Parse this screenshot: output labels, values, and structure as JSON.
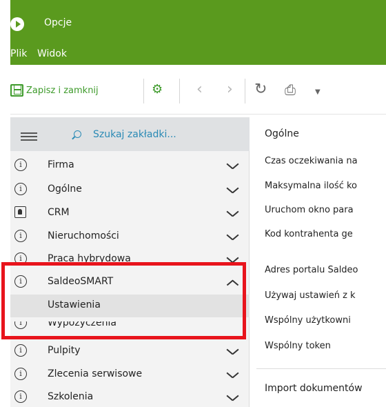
{
  "window": {
    "title": "Opcje"
  },
  "menubar": {
    "items": [
      "Plik",
      "Widok"
    ]
  },
  "toolbar": {
    "save_label": "Zapisz i zamknij",
    "icons": [
      "save-icon",
      "tools-icon",
      "back-icon",
      "forward-icon",
      "refresh-icon",
      "print-icon",
      "dropdown-arrow-icon"
    ]
  },
  "sidebar": {
    "search_placeholder": "Szukaj zakładki...",
    "items": [
      {
        "label": "Firma",
        "icon": "info-icon",
        "expanded": false
      },
      {
        "label": "Ogólne",
        "icon": "info-icon",
        "expanded": false
      },
      {
        "label": "CRM",
        "icon": "contact-card-icon",
        "expanded": false
      },
      {
        "label": "Nieruchomości",
        "icon": "info-icon",
        "expanded": false
      },
      {
        "label": "Praca hybrydowa",
        "icon": "info-icon",
        "expanded": false
      },
      {
        "label": "SaldeoSMART",
        "icon": "info-icon",
        "expanded": true
      },
      {
        "label": "Wypożyczenia",
        "icon": "info-icon",
        "expanded": false
      },
      {
        "label": "Pulpity",
        "icon": "info-icon",
        "expanded": false
      },
      {
        "label": "Zlecenia serwisowe",
        "icon": "info-icon",
        "expanded": false
      },
      {
        "label": "Szkolenia",
        "icon": "info-icon",
        "expanded": false
      }
    ],
    "subitem": "Ustawienia"
  },
  "main": {
    "section_title": "Ogólne",
    "fields": [
      "Czas oczekiwania na",
      "Maksymalna ilość ko",
      "Uruchom okno para",
      "Kod kontrahenta ge",
      "Adres portalu Saldeo",
      "Używaj ustawień z k",
      "Wspólny użytkowni",
      "Wspólny token"
    ],
    "section2_title": "Import dokumentów"
  },
  "colors": {
    "brand_green": "#5a9a1e",
    "accent_green": "#3d9a2a",
    "link_blue": "#2a8ab5",
    "highlight_red": "#e8141c"
  }
}
